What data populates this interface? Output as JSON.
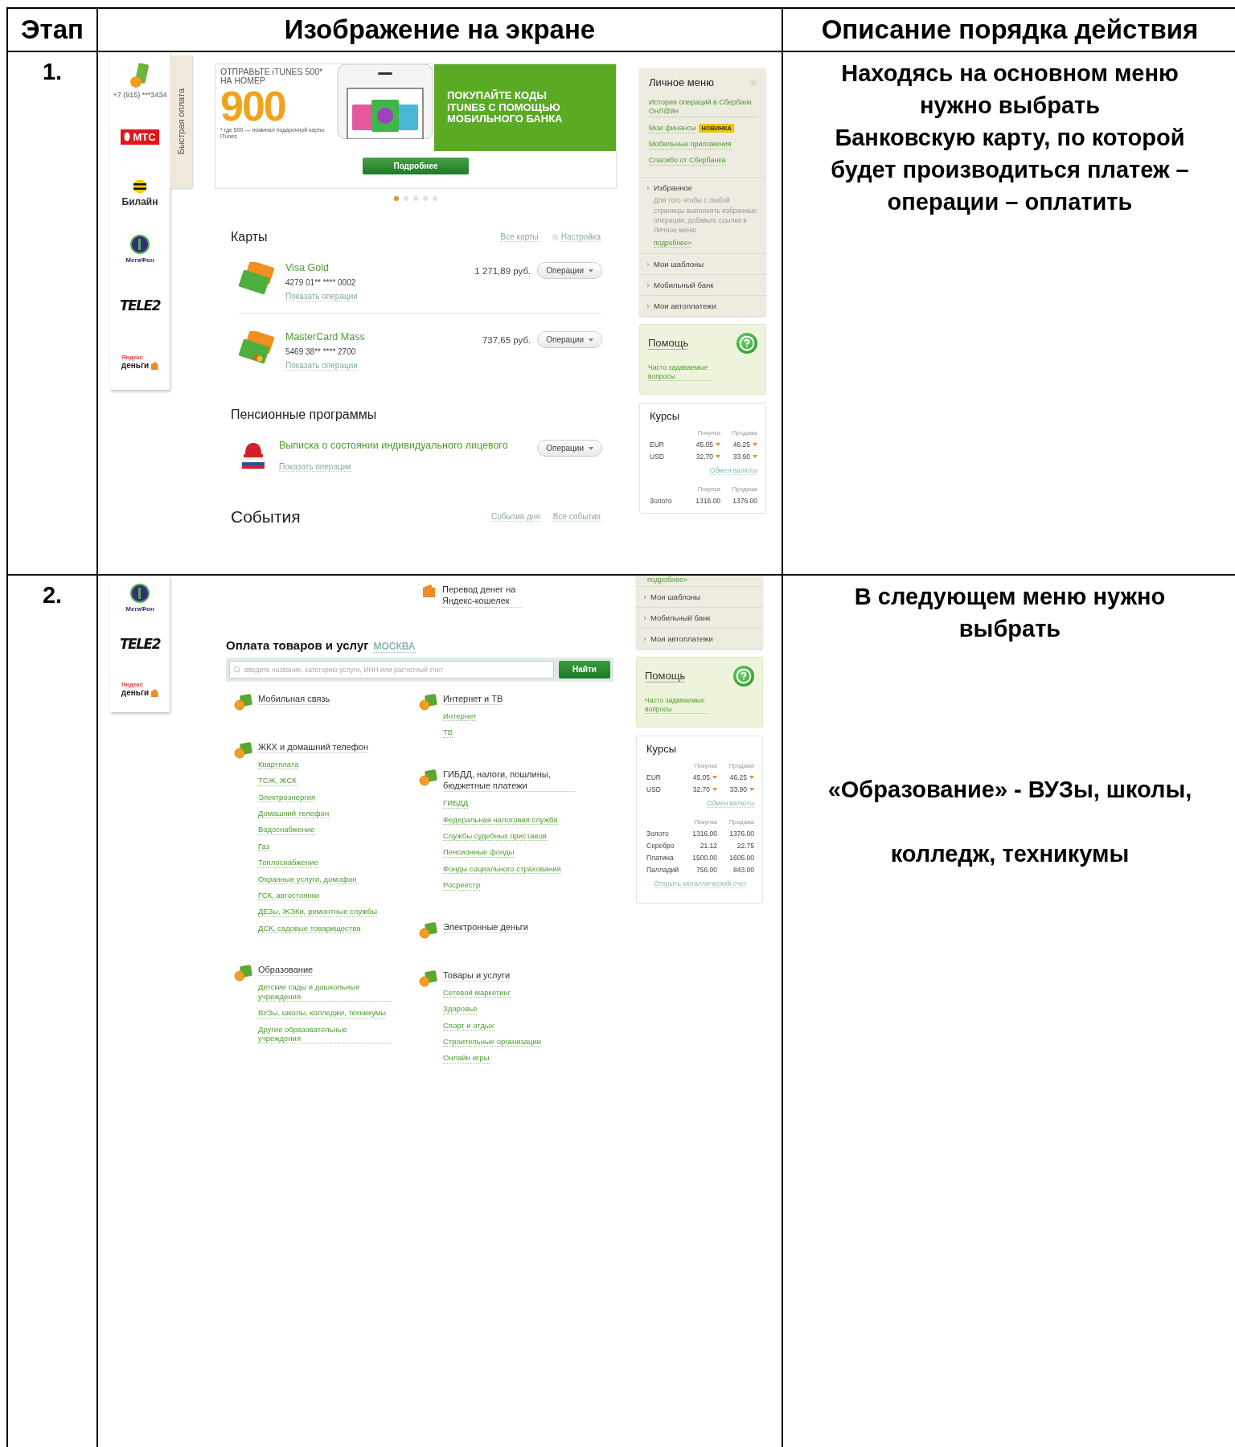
{
  "table": {
    "columns": [
      "Этап",
      "Изображение на экране",
      "Описание порядка действия"
    ],
    "rows": [
      {
        "step": "1.",
        "screen": {
          "kind": "main_page",
          "operators": [
            {
              "kind": "phone",
              "name": "+7 (915) ***3434"
            },
            {
              "kind": "mts",
              "name": "МТС"
            },
            {
              "kind": "beeline",
              "name": "Билайн"
            },
            {
              "kind": "megafon",
              "name": "МегаФон"
            },
            {
              "kind": "tele2",
              "name": "TELE2"
            },
            {
              "kind": "yandex",
              "small": "Яндекс",
              "name": "деньги"
            }
          ],
          "quick_tab": "Быстрая оплата",
          "banner": {
            "line1": "ОТПРАВЬТЕ iTUNES 500*",
            "line2": "НА НОМЕР",
            "number": "900",
            "footnote": "* где 500 — номинал подарочной карты iTunes",
            "promo": "ПОКУПАЙТЕ КОДЫ iTUNES С ПОМОЩЬЮ МОБИЛЬНОГО БАНКА",
            "button": "Подробнее",
            "dots": [
              {
                "selected": true
              },
              {
                "selected": false
              },
              {
                "selected": false
              },
              {
                "selected": false
              },
              {
                "selected": false
              }
            ]
          },
          "cards": {
            "title": "Карты",
            "links": [
              "Все карты",
              "Настройка"
            ],
            "items": [
              {
                "kind": "gold",
                "name": "Visa Gold",
                "number": "4279 01** **** 0002",
                "amount": "1 271,89 руб.",
                "button": "Операции",
                "link": "Показать операции"
              },
              {
                "kind": "standard",
                "name": "MasterCard Mass",
                "number": "5469 38** **** 2700",
                "amount": "737,65 руб.",
                "button": "Операции",
                "link": "Показать операции"
              }
            ]
          },
          "pension": {
            "title": "Пенсионные программы",
            "items": [
              {
                "name": "Выписка о состоянии индивидуального лицевого",
                "button": "Операции",
                "link": "Показать операции"
              }
            ]
          },
          "events": {
            "title": "События",
            "links": [
              "События дня",
              "Все события"
            ]
          },
          "personal_menu": {
            "title": "Личное меню",
            "links": [
              {
                "label": "История операций в Сбербанк ОнЛ@йн"
              },
              {
                "label": "Мои финансы",
                "badge": "НОВИНКА"
              },
              {
                "label": "Мобильные приложения"
              },
              {
                "label": "Спасибо от Сбербанка"
              }
            ],
            "sections": [
              {
                "label": "Избранное",
                "text": "Для того чтобы с любой страницы выполнять избранные операции, добавьте ссылки в Личное меню",
                "link": "подробнее»"
              },
              {
                "label": "Мои шаблоны"
              },
              {
                "label": "Мобильный банк"
              },
              {
                "label": "Мои автоплатежи"
              }
            ]
          },
          "help": {
            "title": "Помощь",
            "link": "Часто задаваемые вопросы"
          },
          "rates": {
            "title": "Курсы",
            "headers": [
              "Покупка",
              "Продажа"
            ],
            "currencies": [
              {
                "code": "EUR",
                "buy": "45.05",
                "sell": "46.25"
              },
              {
                "code": "USD",
                "buy": "32.70",
                "sell": "33.90"
              }
            ],
            "exchange_link": "Обмен валюты",
            "metal_headers": [
              "Покупка",
              "Продажа"
            ],
            "metals": [
              {
                "name": "Золото",
                "buy": "1316.00",
                "sell": "1376.00"
              }
            ]
          }
        },
        "description": [
          "Находясь на основном меню\nнужно выбрать\nБанковскую карту, по которой\nбудет производиться платеж –\nоперации – оплатить"
        ]
      },
      {
        "step": "2.",
        "screen": {
          "kind": "payments_page",
          "operators": [
            {
              "kind": "megafon",
              "name": "МегаФон"
            },
            {
              "kind": "tele2",
              "name": "TELE2"
            },
            {
              "kind": "yandex",
              "small": "Яндекс",
              "name": "деньги"
            }
          ],
          "transfer": "Перевод денег на Яндекс-кошелек",
          "title": "Оплата товаров и услуг",
          "region": "МОСКВА",
          "search": {
            "placeholder": "введите название, категорию услуги, ИНН или расчетный счет",
            "button": "Найти"
          },
          "categories": [
            [
              {
                "title": "Мобильная связь"
              },
              {
                "title": "ЖКХ и домашний телефон",
                "links": [
                  "Квартплата",
                  "ТСЖ, ЖСК",
                  "Электроэнергия",
                  "Домашний телефон",
                  "Водоснабжение",
                  "Газ",
                  "Теплоснабжение",
                  "Охранные услуги, домофон",
                  "ГСК, автостоянки",
                  "ДЕЗы, ЖЭКи, ремонтные службы",
                  "ДСК, садовые товарищества"
                ]
              },
              {
                "title": "Образование",
                "links": [
                  "Детские сады и дошкольные учреждения",
                  "ВУЗы, школы, колледжи, техникумы",
                  "Другие образовательные учреждения"
                ]
              }
            ],
            [
              {
                "title": "Интернет и ТВ",
                "links": [
                  "Интернет",
                  "ТВ"
                ]
              },
              {
                "title": "ГИБДД, налоги, пошлины, бюджетные платежи",
                "links": [
                  "ГИБДД",
                  "Федеральная налоговая служба",
                  "Службы судебных приставов",
                  "Пенсионные фонды",
                  "Фонды социального страхования",
                  "Росреестр"
                ]
              },
              {
                "title": "Электронные деньги"
              },
              {
                "title": "Товары и услуги",
                "links": [
                  "Сетевой маркетинг",
                  "Здоровье",
                  "Спорт и отдых",
                  "Строительные организации",
                  "Онлайн игры"
                ]
              }
            ]
          ],
          "personal_menu": {
            "cut_link": "подробнее»",
            "sections": [
              {
                "label": "Мои шаблоны"
              },
              {
                "label": "Мобильный банк"
              },
              {
                "label": "Мои автоплатежи"
              }
            ]
          },
          "help": {
            "title": "Помощь",
            "link": "Часто задаваемые вопросы"
          },
          "rates": {
            "title": "Курсы",
            "headers": [
              "Покупка",
              "Продажа"
            ],
            "currencies": [
              {
                "code": "EUR",
                "buy": "45.05",
                "sell": "46.25"
              },
              {
                "code": "USD",
                "buy": "32.70",
                "sell": "33.90"
              }
            ],
            "exchange_link": "Обмен валюты",
            "metal_headers": [
              "Покупка",
              "Продажа"
            ],
            "metals": [
              {
                "name": "Золото",
                "buy": "1316.00",
                "sell": "1376.00"
              },
              {
                "name": "Серебро",
                "buy": "21.12",
                "sell": "22.75"
              },
              {
                "name": "Платина",
                "buy": "1500.00",
                "sell": "1605.00"
              },
              {
                "name": "Палладий",
                "buy": "756.00",
                "sell": "843.00"
              }
            ],
            "metal_link": "Открыть металлический счет"
          }
        },
        "description": [
          "В следующем меню нужно\nвыбрать",
          "«Образование» - ВУЗы, школы,",
          "колледж, техникумы"
        ]
      }
    ]
  }
}
